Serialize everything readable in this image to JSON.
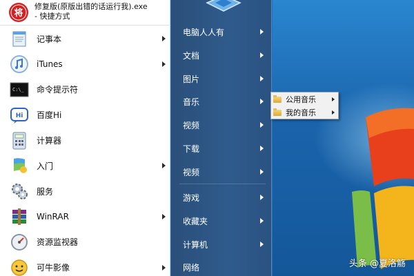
{
  "start_menu": {
    "pinned_item": {
      "title_line1": "修复版(原版出错的话运行我).exe",
      "title_line2": "- 快捷方式",
      "icon": "red-seal-app-icon",
      "icon_char": "将"
    },
    "programs": [
      {
        "label": "记事本",
        "icon": "notepad-icon",
        "has_submenu": true
      },
      {
        "label": "iTunes",
        "icon": "itunes-icon",
        "has_submenu": true
      },
      {
        "label": "命令提示符",
        "icon": "cmd-icon",
        "has_submenu": false
      },
      {
        "label": "百度Hi",
        "icon": "baidu-hi-icon",
        "icon_text": "Hi",
        "has_submenu": false
      },
      {
        "label": "计算器",
        "icon": "calculator-icon",
        "has_submenu": false
      },
      {
        "label": "入门",
        "icon": "getting-started-icon",
        "has_submenu": true
      },
      {
        "label": "服务",
        "icon": "services-icon",
        "has_submenu": false
      },
      {
        "label": "WinRAR",
        "icon": "winrar-icon",
        "has_submenu": true
      },
      {
        "label": "资源监视器",
        "icon": "resource-monitor-icon",
        "has_submenu": false
      },
      {
        "label": "可牛影像",
        "icon": "keniu-image-icon",
        "has_submenu": true
      }
    ],
    "right_pane": [
      {
        "label": "电脑人人有",
        "has_submenu": true
      },
      {
        "label": "文档",
        "has_submenu": true
      },
      {
        "label": "图片",
        "has_submenu": true
      },
      {
        "label": "音乐",
        "has_submenu": true,
        "expanded": true
      },
      {
        "label": "视频",
        "has_submenu": true
      },
      {
        "label": "下载",
        "has_submenu": true
      },
      {
        "label": "视频",
        "has_submenu": true
      },
      {
        "label": "游戏",
        "has_submenu": true
      },
      {
        "label": "收藏夹",
        "has_submenu": true
      },
      {
        "label": "计算机",
        "has_submenu": true
      },
      {
        "label": "网络",
        "has_submenu": false
      }
    ],
    "music_submenu": [
      {
        "label": "公用音乐",
        "icon": "folder-icon"
      },
      {
        "label": "我的音乐",
        "icon": "folder-icon"
      }
    ]
  },
  "watermark": "头条 @夏洛觞",
  "colors": {
    "left_pane_bg": "#ffffff",
    "right_pane_bg": "#2f5b8c",
    "desktop_bg": "#1a64ac",
    "seal_red": "#d42020"
  }
}
